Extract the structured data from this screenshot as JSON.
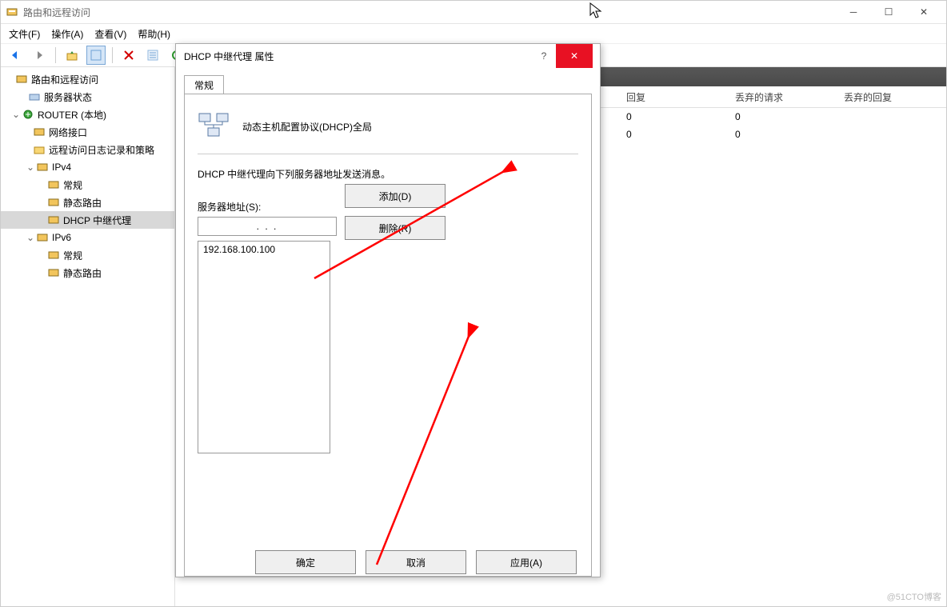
{
  "window": {
    "title": "路由和远程访问"
  },
  "menu": {
    "file": "文件(F)",
    "action": "操作(A)",
    "view": "查看(V)",
    "help": "帮助(H)"
  },
  "tree": {
    "root": "路由和远程访问",
    "server_status": "服务器状态",
    "router": "ROUTER (本地)",
    "net_if": "网络接口",
    "remote_log": "远程访问日志记录和策略",
    "ipv4": "IPv4",
    "ipv4_general": "常规",
    "ipv4_static": "静态路由",
    "ipv4_dhcp": "DHCP 中继代理",
    "ipv6": "IPv6",
    "ipv6_general": "常规",
    "ipv6_static": "静态路由"
  },
  "grid": {
    "cols": {
      "reply": "回复",
      "discard_req": "丢弃的请求",
      "discard_reply": "丢弃的回复"
    },
    "rows": [
      {
        "reply": "0",
        "discard_req": "0",
        "discard_reply": ""
      },
      {
        "reply": "0",
        "discard_req": "0",
        "discard_reply": ""
      }
    ]
  },
  "dialog": {
    "title": "DHCP 中继代理 属性",
    "tab": "常规",
    "heading": "动态主机配置协议(DHCP)全局",
    "desc": "DHCP 中继代理向下列服务器地址发送消息。",
    "server_addr_label": "服务器地址(S):",
    "ip_placeholder": ".    .    .",
    "list_item": "192.168.100.100",
    "add": "添加(D)",
    "delete": "删除(R)",
    "ok": "确定",
    "cancel": "取消",
    "apply": "应用(A)"
  },
  "watermark": "@51CTO博客"
}
